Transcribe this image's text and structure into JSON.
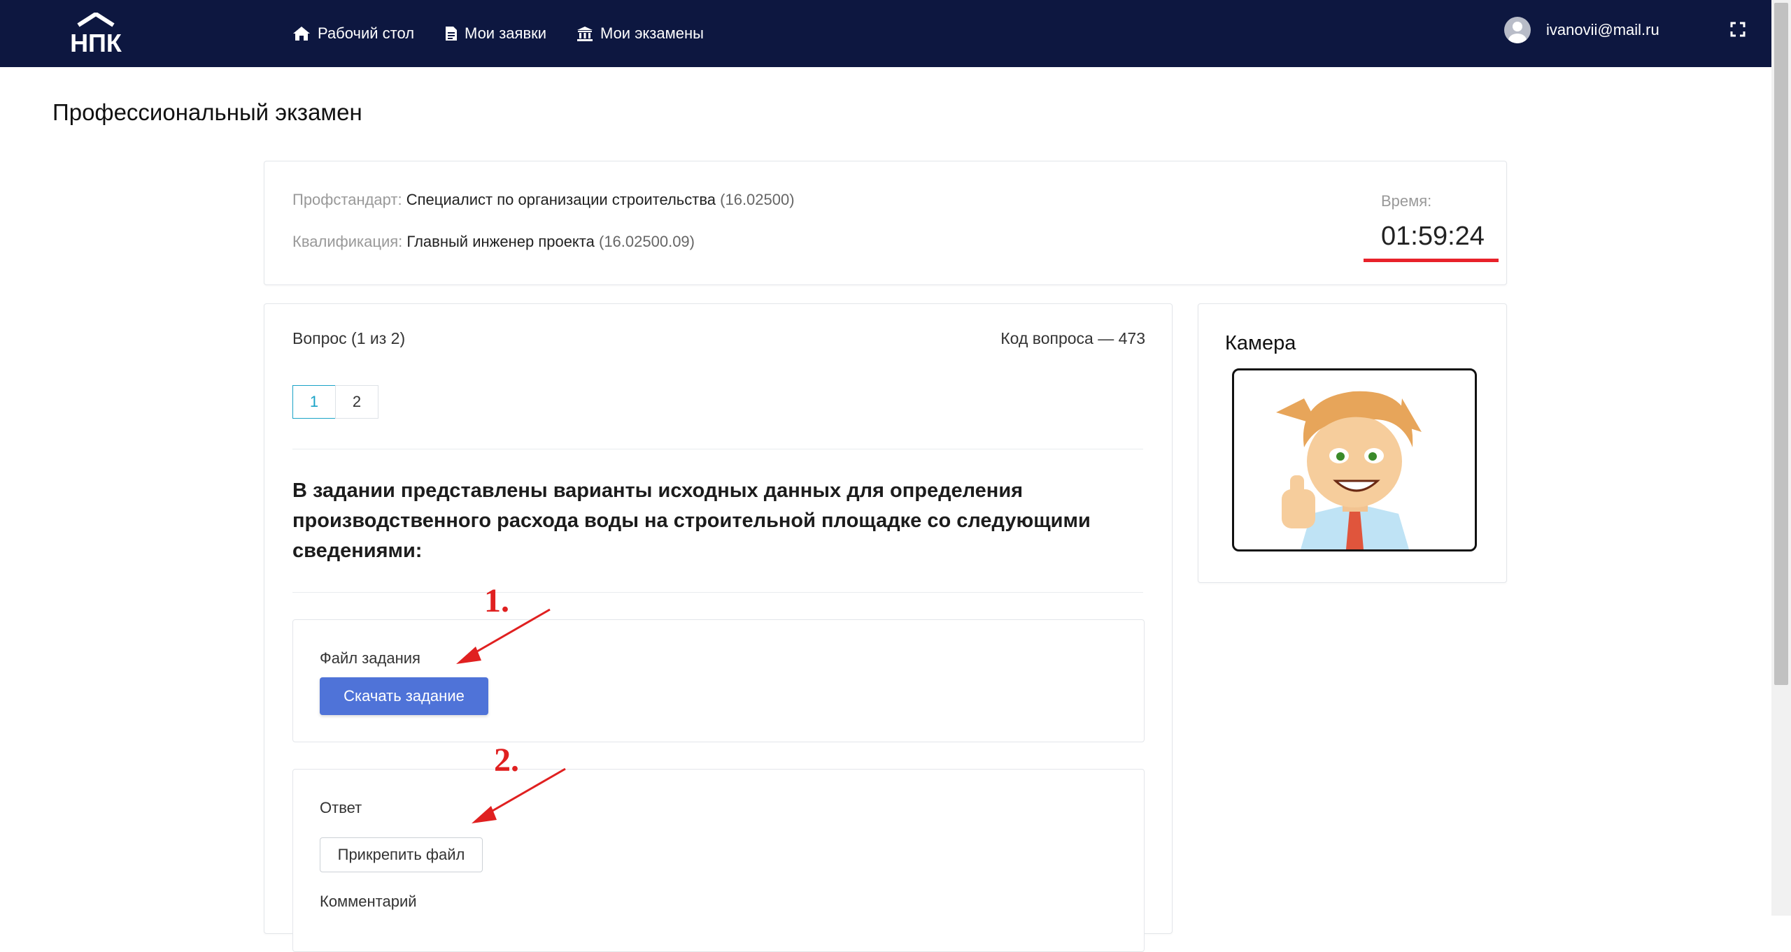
{
  "navbar": {
    "logo_text": "НПК",
    "items": [
      {
        "label": "Рабочий стол",
        "icon": "home-icon"
      },
      {
        "label": "Мои заявки",
        "icon": "document-icon"
      },
      {
        "label": "Мои экзамены",
        "icon": "institution-icon"
      }
    ],
    "user_email": "ivanovii@mail.ru"
  },
  "page": {
    "title": "Профессиональный экзамен"
  },
  "info": {
    "standard_label": "Профстандарт:",
    "standard_value": "Специалист по организации строительства",
    "standard_code": "(16.02500)",
    "qualification_label": "Квалификация:",
    "qualification_value": "Главный инженер проекта",
    "qualification_code": "(16.02500.09)",
    "time_label": "Время:",
    "time_value": "01:59:24"
  },
  "question": {
    "header": "Вопрос (1 из 2)",
    "code": "Код вопроса — 473",
    "pages": [
      "1",
      "2"
    ],
    "active_page": "1",
    "text": "В задании представлены варианты исходных данных для определения производственного расхода воды на строительной площадке со следующими сведениями:",
    "task_file_label": "Файл задания",
    "download_button": "Скачать задание",
    "answer_label": "Ответ",
    "attach_button": "Прикрепить файл",
    "comment_label": "Комментарий"
  },
  "camera": {
    "title": "Камера"
  },
  "annotations": {
    "first": "1.",
    "second": "2."
  },
  "colors": {
    "navbar_bg": "#0d1740",
    "accent_red": "#e8222a",
    "primary_button": "#4f73d8",
    "active_page": "#1aa3c7"
  }
}
